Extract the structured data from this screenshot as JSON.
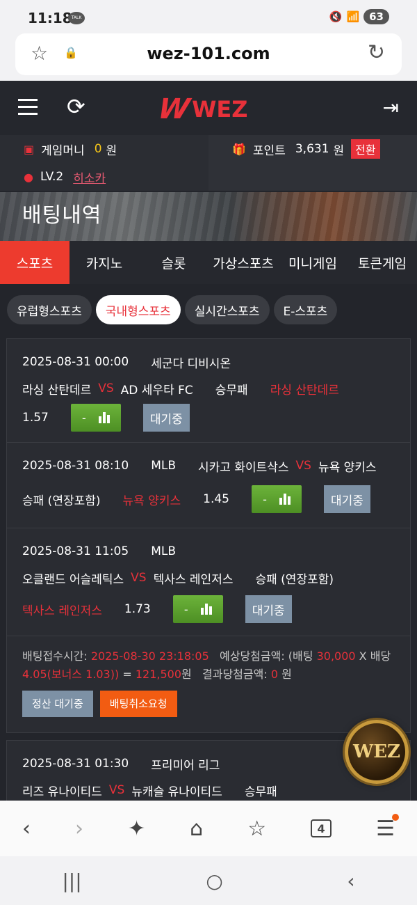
{
  "status": {
    "time": "11:18",
    "talk": "TALK",
    "battery": "63"
  },
  "browser": {
    "url": "wez-101.com"
  },
  "site": {
    "logo": "WEZ",
    "money": {
      "label": "게임머니",
      "value": "0",
      "unit": "원"
    },
    "points": {
      "label": "포인트",
      "value": "3,631",
      "unit": "원",
      "convert": "전환"
    },
    "level": {
      "label": "LV.2",
      "nickname": "히소카"
    },
    "banner_title": "배팅내역",
    "tabs": [
      "스포츠",
      "카지노",
      "슬롯",
      "가상스포츠",
      "미니게임",
      "토큰게임"
    ],
    "subtabs": [
      "유럽형스포츠",
      "국내형스포츠",
      "실시간스포츠",
      "E-스포츠"
    ]
  },
  "bets": [
    {
      "datetime": "2025-08-31 00:00",
      "league": "세군다 디비시온",
      "home": "라싱 산탄데르",
      "vs": "VS",
      "away": "AD 세우타 FC",
      "market": "승무패",
      "pick": "라싱 산탄데르",
      "odds": "1.57",
      "result": "-",
      "status": "대기중"
    },
    {
      "datetime": "2025-08-31 08:10",
      "league": "MLB",
      "home": "시카고 화이트삭스",
      "vs": "VS",
      "away": "뉴욕 양키스",
      "market": "승패 (연장포함)",
      "pick": "뉴욕 양키스",
      "odds": "1.45",
      "result": "-",
      "status": "대기중"
    },
    {
      "datetime": "2025-08-31 11:05",
      "league": "MLB",
      "home": "오클랜드 어슬레틱스",
      "vs": "VS",
      "away": "텍사스 레인저스",
      "market": "승패 (연장포함)",
      "pick": "텍사스 레인저스",
      "odds": "1.73",
      "result": "-",
      "status": "대기중"
    }
  ],
  "summary": {
    "time_label": "배팅접수시간:",
    "time_value": "2025-08-30 23:18:05",
    "expected_label": "예상당첨금액: (배팅",
    "stake": "30,000",
    "x": "X 배당",
    "total_odds": "4.05(보너스 1.03))",
    "equals": "=",
    "expected_value": "121,500",
    "won": "원",
    "result_label": "결과당첨금액:",
    "result_value": "0",
    "result_unit": "원",
    "settle_button": "정산 대기중",
    "cancel_button": "배팅취소요청"
  },
  "bet4": {
    "datetime": "2025-08-31 01:30",
    "league": "프리미어 리그",
    "home": "리즈 유나이티드",
    "vs": "VS",
    "away": "뉴캐슬 유나이티드",
    "market": "승무패"
  },
  "coin": "WEZ",
  "bottombar": {
    "tabs_count": "4"
  }
}
